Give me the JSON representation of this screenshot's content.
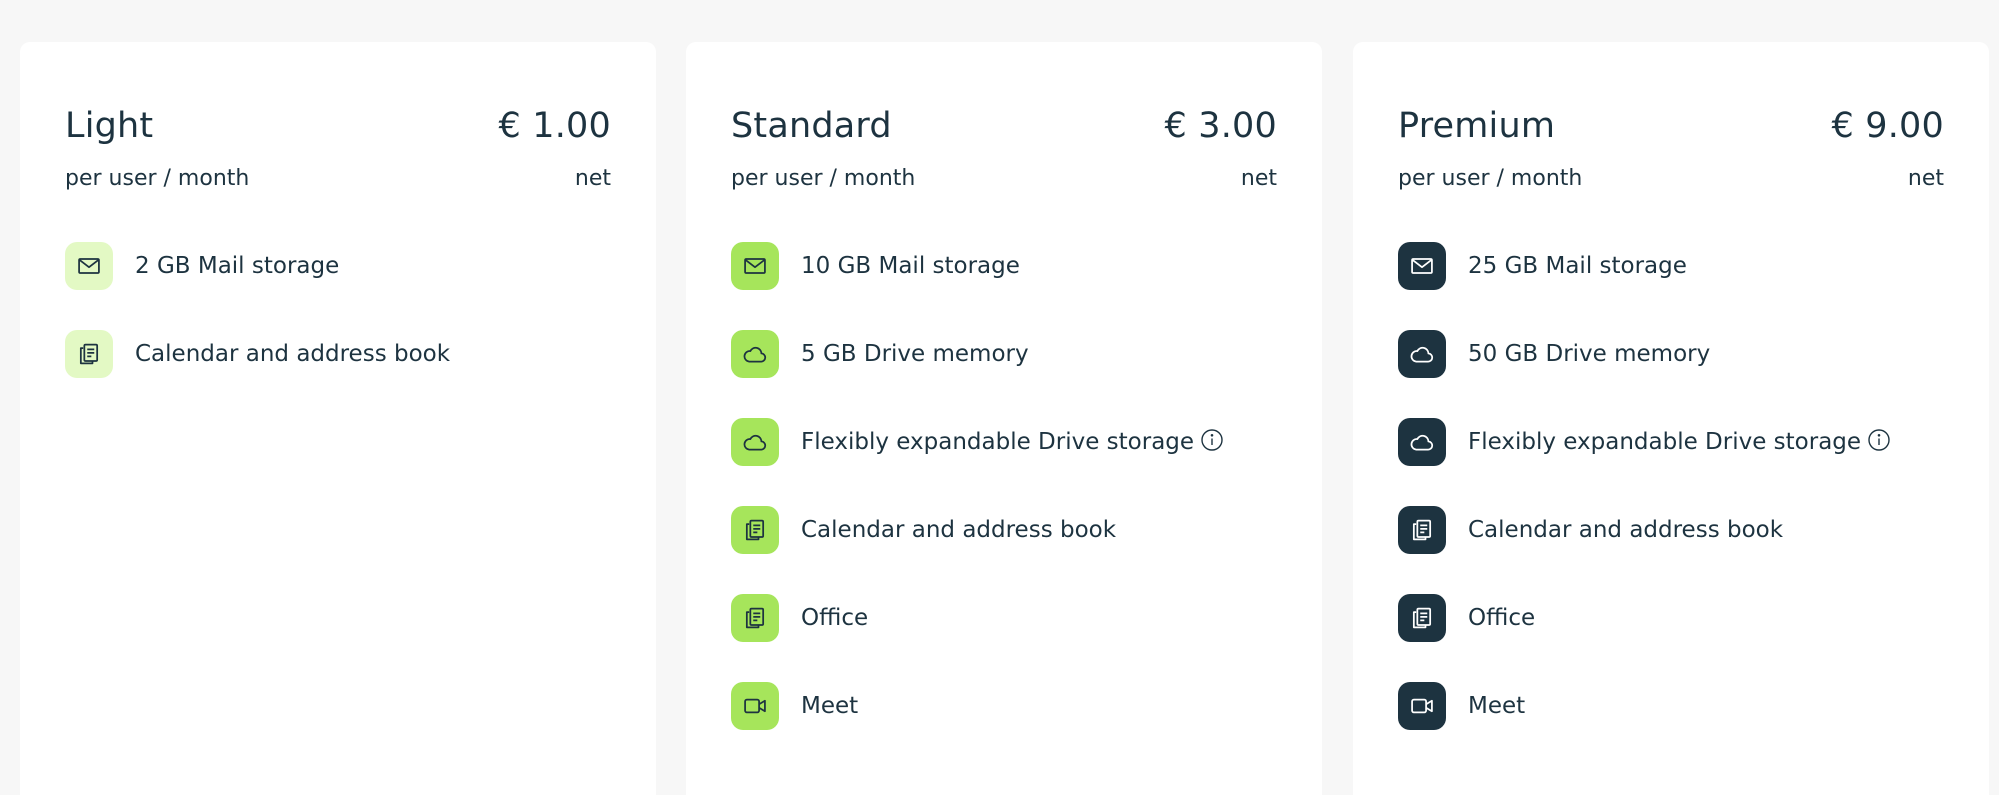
{
  "plans": [
    {
      "name": "Light",
      "price": "€ 1.00",
      "period": "per user / month",
      "net": "net",
      "features": [
        {
          "label": "2 GB Mail storage",
          "icon": "mail-icon"
        },
        {
          "label": "Calendar and address book",
          "icon": "documents-icon"
        }
      ]
    },
    {
      "name": "Standard",
      "price": "€ 3.00",
      "period": "per user / month",
      "net": "net",
      "features": [
        {
          "label": "10 GB Mail storage",
          "icon": "mail-icon"
        },
        {
          "label": "5 GB Drive memory",
          "icon": "cloud-icon"
        },
        {
          "label": "Flexibly expandable Drive storage",
          "icon": "cloud-icon",
          "info": "info-icon"
        },
        {
          "label": "Calendar and address book",
          "icon": "documents-icon"
        },
        {
          "label": "Office",
          "icon": "documents-icon"
        },
        {
          "label": "Meet",
          "icon": "video-camera-icon"
        }
      ]
    },
    {
      "name": "Premium",
      "price": "€ 9.00",
      "period": "per user / month",
      "net": "net",
      "features": [
        {
          "label": "25 GB Mail storage",
          "icon": "mail-icon"
        },
        {
          "label": "50 GB Drive memory",
          "icon": "cloud-icon"
        },
        {
          "label": "Flexibly expandable Drive storage",
          "icon": "cloud-icon",
          "info": "info-icon"
        },
        {
          "label": "Calendar and address book",
          "icon": "documents-icon"
        },
        {
          "label": "Office",
          "icon": "documents-icon"
        },
        {
          "label": "Meet",
          "icon": "video-camera-icon"
        }
      ]
    }
  ],
  "colors": {
    "page_background": "#f7f7f7",
    "card_background": "#ffffff",
    "text": "#1d3340",
    "light_icon_bg": "#e3f9c4",
    "standard_icon_bg": "#a6e55b",
    "premium_icon_bg": "#1d3340"
  }
}
